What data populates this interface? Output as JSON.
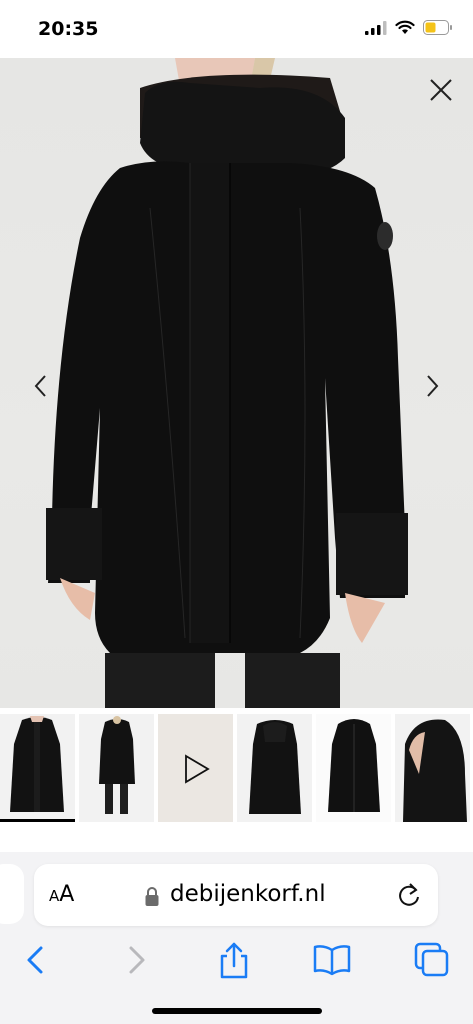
{
  "status_bar": {
    "time": "20:35"
  },
  "main_image": {
    "alt": "Black hooded parka coat worn by model"
  },
  "thumbnails": [
    {
      "kind": "front-view",
      "selected": true
    },
    {
      "kind": "full-body-view",
      "selected": false
    },
    {
      "kind": "video",
      "selected": false
    },
    {
      "kind": "back-view",
      "selected": false
    },
    {
      "kind": "product-only",
      "selected": false
    },
    {
      "kind": "hood-detail",
      "selected": false
    }
  ],
  "browser": {
    "text_size_label_small": "A",
    "text_size_label_large": "A",
    "domain": "debijenkorf.nl"
  },
  "colors": {
    "accent": "#1a7cf5",
    "disabled": "#b8b8bc",
    "battery": "#f4c319"
  },
  "icons": [
    "close-icon",
    "chevron-left-icon",
    "chevron-right-icon",
    "play-icon",
    "lock-icon",
    "reload-icon",
    "back-icon",
    "forward-icon",
    "share-icon",
    "bookmarks-icon",
    "tabs-icon"
  ]
}
